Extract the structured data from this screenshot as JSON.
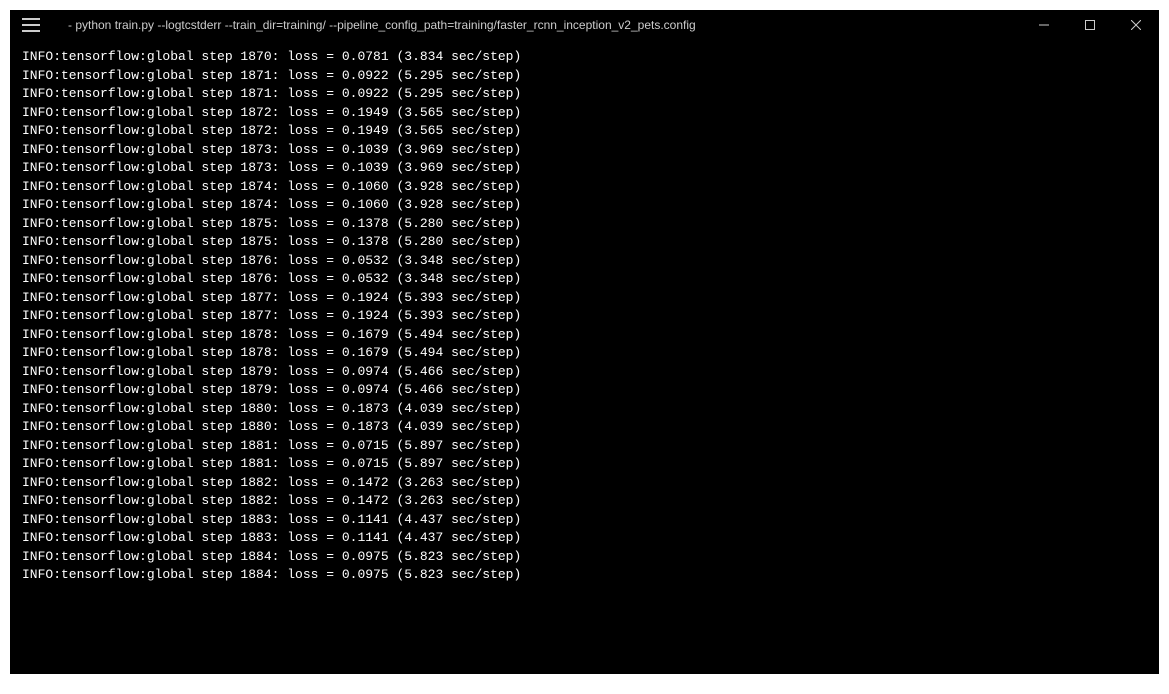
{
  "window": {
    "title": "- python  train.py --logtcstderr --train_dir=training/ --pipeline_config_path=training/faster_rcnn_inception_v2_pets.config"
  },
  "log": {
    "prefix": "INFO:tensorflow:global step",
    "lines": [
      {
        "step": "1870",
        "loss": "0.0781",
        "time": "3.834"
      },
      {
        "step": "1871",
        "loss": "0.0922",
        "time": "5.295"
      },
      {
        "step": "1871",
        "loss": "0.0922",
        "time": "5.295"
      },
      {
        "step": "1872",
        "loss": "0.1949",
        "time": "3.565"
      },
      {
        "step": "1872",
        "loss": "0.1949",
        "time": "3.565"
      },
      {
        "step": "1873",
        "loss": "0.1039",
        "time": "3.969"
      },
      {
        "step": "1873",
        "loss": "0.1039",
        "time": "3.969"
      },
      {
        "step": "1874",
        "loss": "0.1060",
        "time": "3.928"
      },
      {
        "step": "1874",
        "loss": "0.1060",
        "time": "3.928"
      },
      {
        "step": "1875",
        "loss": "0.1378",
        "time": "5.280"
      },
      {
        "step": "1875",
        "loss": "0.1378",
        "time": "5.280"
      },
      {
        "step": "1876",
        "loss": "0.0532",
        "time": "3.348"
      },
      {
        "step": "1876",
        "loss": "0.0532",
        "time": "3.348"
      },
      {
        "step": "1877",
        "loss": "0.1924",
        "time": "5.393"
      },
      {
        "step": "1877",
        "loss": "0.1924",
        "time": "5.393"
      },
      {
        "step": "1878",
        "loss": "0.1679",
        "time": "5.494"
      },
      {
        "step": "1878",
        "loss": "0.1679",
        "time": "5.494"
      },
      {
        "step": "1879",
        "loss": "0.0974",
        "time": "5.466"
      },
      {
        "step": "1879",
        "loss": "0.0974",
        "time": "5.466"
      },
      {
        "step": "1880",
        "loss": "0.1873",
        "time": "4.039"
      },
      {
        "step": "1880",
        "loss": "0.1873",
        "time": "4.039"
      },
      {
        "step": "1881",
        "loss": "0.0715",
        "time": "5.897"
      },
      {
        "step": "1881",
        "loss": "0.0715",
        "time": "5.897"
      },
      {
        "step": "1882",
        "loss": "0.1472",
        "time": "3.263"
      },
      {
        "step": "1882",
        "loss": "0.1472",
        "time": "3.263"
      },
      {
        "step": "1883",
        "loss": "0.1141",
        "time": "4.437"
      },
      {
        "step": "1883",
        "loss": "0.1141",
        "time": "4.437"
      },
      {
        "step": "1884",
        "loss": "0.0975",
        "time": "5.823"
      },
      {
        "step": "1884",
        "loss": "0.0975",
        "time": "5.823"
      }
    ]
  }
}
